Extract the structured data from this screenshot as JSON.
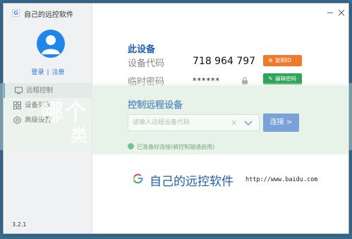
{
  "window": {
    "title": "自己的远控软件"
  },
  "sidebar": {
    "auth": {
      "login": "登录",
      "separator": "|",
      "register": "注册"
    },
    "nav": [
      {
        "label": "远程控制",
        "icon": "monitor-icon",
        "active": true
      },
      {
        "label": "设备列表",
        "icon": "grid-icon",
        "active": false
      },
      {
        "label": "高级设置",
        "icon": "settings-icon",
        "active": false
      }
    ],
    "version": "3.2.1"
  },
  "device": {
    "section_title": "此设备",
    "code_label": "设备代码",
    "code_value": "718 964 797",
    "copy_button": "复制ID",
    "temp_pwd_label": "临时密码",
    "temp_pwd_value": "******",
    "edit_button": "编辑密码"
  },
  "connect": {
    "section_title": "控制远程设备",
    "input_placeholder": "请输入远程设备代码",
    "clear_symbol": "✕",
    "connect_button": "连接 >",
    "status_text": "已准备好连接(被控制端请启用)"
  },
  "watermark": {
    "line1": "哪个 ",
    "line2": "类"
  },
  "brand": {
    "logo_letter": "G",
    "name": "自己的远控软件",
    "url": "http://www.baidu.com"
  },
  "colors": {
    "accent": "#1f5fae",
    "orange": "#f07a2b",
    "green": "#2ea55b",
    "blue": "#3c6fd3"
  }
}
